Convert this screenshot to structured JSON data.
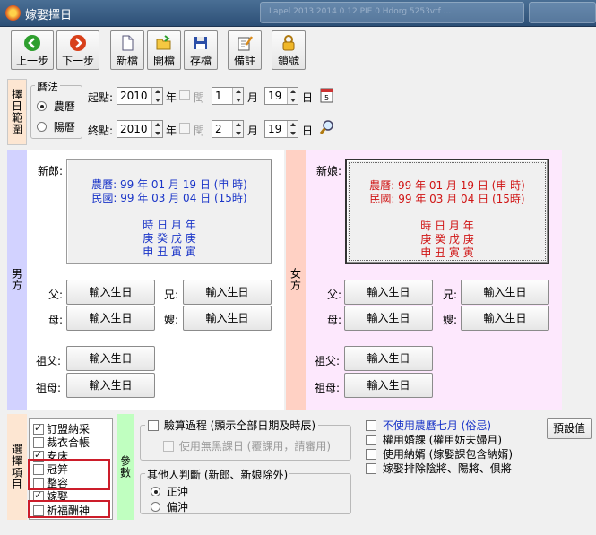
{
  "window": {
    "title": "嫁娶擇日",
    "background_hint": "Lapel 2013 2014 0.12 PIE  0 Hdorg 5253vtf ..."
  },
  "toolbar": {
    "prev": "上一步",
    "next": "下一步",
    "new": "新檔",
    "open": "開檔",
    "save": "存檔",
    "note": "備註",
    "lock": "鎖號"
  },
  "range": {
    "side_label": "擇日範圍",
    "calendar_group": "曆法",
    "lunar": "農曆",
    "solar": "陽曆",
    "start_label": "起點:",
    "end_label": "終點:",
    "start": {
      "year": "2010",
      "month": "1",
      "day": "19"
    },
    "end": {
      "year": "2010",
      "month": "2",
      "day": "19"
    },
    "year_unit": "年",
    "leap": "閏",
    "month_unit": "月",
    "day_unit": "日"
  },
  "male": {
    "side_label": "男方",
    "groom_label": "新郎:",
    "lunar_line": "農曆: 99 年 01 月 19 日 (申 時)",
    "roc_line": "民國: 99 年 03 月 04 日 (15時)",
    "pillar_head": "時 日 月 年",
    "pillar_stem": "庚 癸 戊 庚",
    "pillar_branch": "申 丑 寅 寅",
    "father": "父:",
    "mother": "母:",
    "brother": "兄:",
    "sister_in_law": "嫂:",
    "grandfather": "祖父:",
    "grandmother": "祖母:",
    "enter_birthday": "輸入生日"
  },
  "female": {
    "side_label": "女方",
    "bride_label": "新娘:",
    "lunar_line": "農曆: 99 年 01 月 19 日 (申 時)",
    "roc_line": "民國: 99 年 03 月 04 日 (15時)",
    "pillar_head": "時 日 月 年",
    "pillar_stem": "庚 癸 戊 庚",
    "pillar_branch": "申 丑 寅 寅",
    "father": "父:",
    "mother": "母:",
    "brother": "兄:",
    "sister_in_law": "嫂:",
    "grandfather": "祖父:",
    "grandmother": "祖母:",
    "enter_birthday": "輸入生日"
  },
  "select": {
    "side_label": "選擇項目",
    "items": [
      {
        "label": "訂盟納采",
        "checked": true
      },
      {
        "label": "裁衣合帳",
        "checked": false
      },
      {
        "label": "安床",
        "checked": true
      },
      {
        "label": "冠笄",
        "checked": false
      },
      {
        "label": "整容",
        "checked": false
      },
      {
        "label": "嫁娶",
        "checked": true
      },
      {
        "label": "祈福酬神",
        "checked": false
      }
    ]
  },
  "params": {
    "side_label": "參數",
    "verify_process": "驗算過程 (顯示全部日期及時辰)",
    "use_no_black": "使用無黑課日 (覆課用，請審用)",
    "others_group": "其他人判斷 (新郎、新娘除外)",
    "zheng_chong": "正沖",
    "pian_chong": "偏沖",
    "no_lunar_july": "不使用農曆七月 (俗忌)",
    "use_marriage": "權用婚課 (權用妨夫婦月)",
    "use_nazheng": "使用納婿 (嫁娶課包含納婿)",
    "exclude": "嫁娶排除陰將、陽將、俱將",
    "default_button": "預設值"
  }
}
